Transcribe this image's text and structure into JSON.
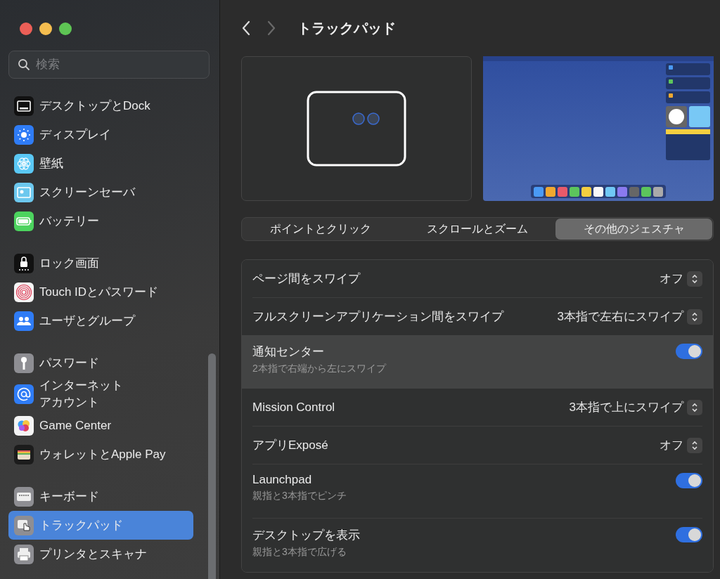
{
  "window": {
    "title": "トラックパッド"
  },
  "nav": [
    {
      "kind": "back",
      "disabled": false
    },
    {
      "kind": "forward",
      "disabled": true
    }
  ],
  "search": {
    "placeholder": "検索"
  },
  "sidebar": {
    "groups": [
      {
        "items": [
          {
            "label": "デスクトップとDock",
            "kind": "desktop",
            "color": "#111111",
            "selected": false
          },
          {
            "label": "ディスプレイ",
            "kind": "display",
            "color": "#2f7cf6",
            "selected": false
          },
          {
            "label": "壁紙",
            "kind": "wallpaper",
            "color": "#5ac8f5",
            "selected": false
          },
          {
            "label": "スクリーンセーバ",
            "kind": "screensaver",
            "color": "#6cc8ee",
            "selected": false
          },
          {
            "label": "バッテリー",
            "kind": "battery",
            "color": "#4cd35e",
            "selected": false
          }
        ]
      },
      {
        "items": [
          {
            "label": "ロック画面",
            "kind": "lock",
            "color": "#111111",
            "selected": false
          },
          {
            "label": "Touch IDとパスワード",
            "kind": "touchid",
            "color": "#f4f4f4",
            "selected": false
          },
          {
            "label": "ユーザとグループ",
            "kind": "users",
            "color": "#2f7cf6",
            "selected": false
          }
        ]
      },
      {
        "items": [
          {
            "label": "パスワード",
            "kind": "password",
            "color": "#8e8e93",
            "selected": false
          },
          {
            "label": "インターネットアカウント",
            "kind": "internet",
            "color": "#2f7cf6",
            "selected": false
          },
          {
            "label": "Game Center",
            "kind": "gamecenter",
            "color": "#f4f4f4",
            "selected": false
          },
          {
            "label": "ウォレットとApple Pay",
            "kind": "wallet",
            "color": "#1c1c1c",
            "selected": false
          }
        ]
      },
      {
        "items": [
          {
            "label": "キーボード",
            "kind": "keyboard",
            "color": "#8e8e93",
            "selected": false
          },
          {
            "label": "トラックパッド",
            "kind": "trackpad",
            "color": "#8e8e93",
            "selected": true
          },
          {
            "label": "プリンタとスキャナ",
            "kind": "printer",
            "color": "#8e8e93",
            "selected": false
          }
        ]
      }
    ]
  },
  "tabs": [
    {
      "label": "ポイントとクリック",
      "selected": false
    },
    {
      "label": "スクロールとズーム",
      "selected": false
    },
    {
      "label": "その他のジェスチャ",
      "selected": true
    }
  ],
  "settings": [
    {
      "kind": "select",
      "title": "ページ間をスワイプ",
      "value": "オフ",
      "selected": false
    },
    {
      "kind": "select",
      "title": "フルスクリーンアプリケーション間をスワイプ",
      "value": "3本指で左右にスワイプ",
      "selected": false
    },
    {
      "kind": "toggle",
      "title": "通知センター",
      "subtitle": "2本指で右端から左にスワイプ",
      "on": true,
      "selected": true
    },
    {
      "kind": "select",
      "title": "Mission Control",
      "value": "3本指で上にスワイプ",
      "selected": false
    },
    {
      "kind": "select",
      "title": "アプリExposé",
      "value": "オフ",
      "selected": false
    },
    {
      "kind": "toggle",
      "title": "Launchpad",
      "subtitle": "親指と3本指でピンチ",
      "on": true,
      "selected": false
    },
    {
      "kind": "toggle",
      "title": "デスクトップを表示",
      "subtitle": "親指と3本指で広げる",
      "on": true,
      "selected": false
    }
  ]
}
